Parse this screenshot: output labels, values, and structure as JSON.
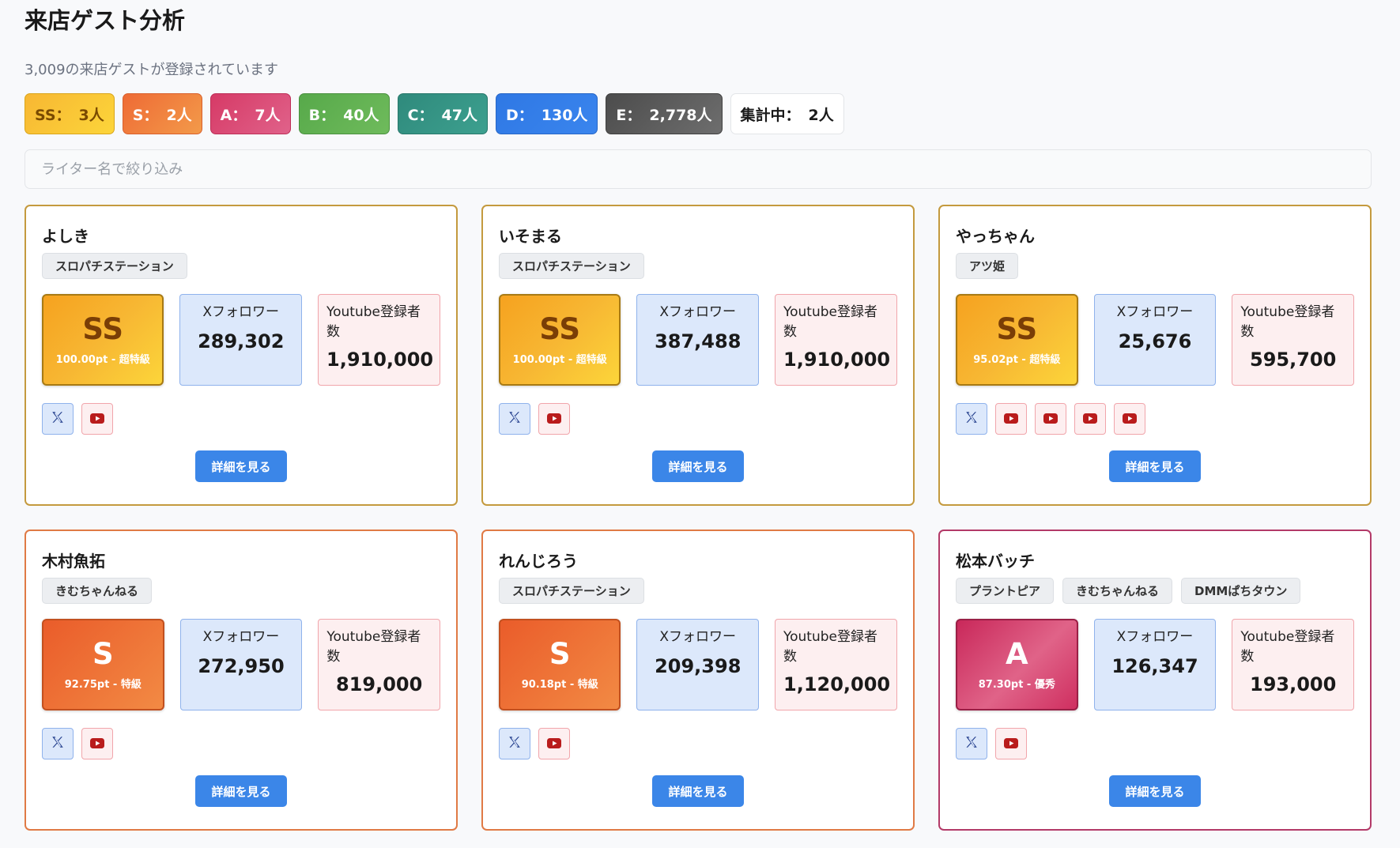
{
  "header": {
    "title": "来店ゲスト分析",
    "subtitle": "3,009の来店ゲストが登録されています"
  },
  "summary": [
    {
      "label": "SS：",
      "count": "3人",
      "cls": "b-ss"
    },
    {
      "label": "S：",
      "count": "2人",
      "cls": "b-s"
    },
    {
      "label": "A：",
      "count": "7人",
      "cls": "b-a"
    },
    {
      "label": "B：",
      "count": "40人",
      "cls": "b-b"
    },
    {
      "label": "C：",
      "count": "47人",
      "cls": "b-c"
    },
    {
      "label": "D：",
      "count": "130人",
      "cls": "b-d"
    },
    {
      "label": "E：",
      "count": "2,778人",
      "cls": "b-e"
    },
    {
      "label": "集計中：",
      "count": "2人",
      "cls": "b-p"
    }
  ],
  "search": {
    "placeholder": "ライター名で絞り込み"
  },
  "labels": {
    "x_followers": "Xフォロワー",
    "yt_subscribers": "Youtube登録者数",
    "detail_button": "詳細を見る"
  },
  "colors": {
    "ss": "#f7b733",
    "s": "#ee6b35",
    "a": "#d63a66",
    "b": "#57a94a",
    "c": "#2f8a7c",
    "d": "#2f78e4",
    "e": "#4c4c4c",
    "primary": "#3b86e8"
  },
  "cards": [
    {
      "name": "よしき",
      "tags": [
        "スロパチステーション"
      ],
      "rank": "SS",
      "rank_cls": "ss",
      "points": "100.00pt - 超特級",
      "x_followers": "289,302",
      "yt_subscribers": "1,910,000",
      "youtube_links": 1
    },
    {
      "name": "いそまる",
      "tags": [
        "スロパチステーション"
      ],
      "rank": "SS",
      "rank_cls": "ss",
      "points": "100.00pt - 超特級",
      "x_followers": "387,488",
      "yt_subscribers": "1,910,000",
      "youtube_links": 1
    },
    {
      "name": "やっちゃん",
      "tags": [
        "アツ姫"
      ],
      "rank": "SS",
      "rank_cls": "ss",
      "points": "95.02pt - 超特級",
      "x_followers": "25,676",
      "yt_subscribers": "595,700",
      "youtube_links": 4
    },
    {
      "name": "木村魚拓",
      "tags": [
        "きむちゃんねる"
      ],
      "rank": "S",
      "rank_cls": "s",
      "points": "92.75pt - 特級",
      "x_followers": "272,950",
      "yt_subscribers": "819,000",
      "youtube_links": 1
    },
    {
      "name": "れんじろう",
      "tags": [
        "スロパチステーション"
      ],
      "rank": "S",
      "rank_cls": "s",
      "points": "90.18pt - 特級",
      "x_followers": "209,398",
      "yt_subscribers": "1,120,000",
      "youtube_links": 1
    },
    {
      "name": "松本バッチ",
      "tags": [
        "プラントピア",
        "きむちゃんねる",
        "DMMぱちタウン"
      ],
      "rank": "A",
      "rank_cls": "a",
      "points": "87.30pt - 優秀",
      "x_followers": "126,347",
      "yt_subscribers": "193,000",
      "youtube_links": 1
    }
  ]
}
